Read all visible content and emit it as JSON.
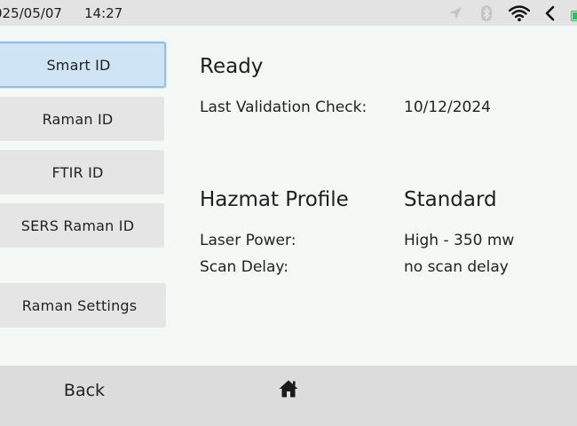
{
  "statusbar": {
    "date": "025/05/07",
    "time": "14:27",
    "icons": [
      "location-icon",
      "bluetooth-icon",
      "wifi-icon",
      "back-chevron-icon",
      "battery-icon"
    ],
    "battery_color": "#22c55e"
  },
  "nav": {
    "items": [
      {
        "label": "Smart ID",
        "selected": true
      },
      {
        "label": "Raman ID",
        "selected": false
      },
      {
        "label": "FTIR ID",
        "selected": false
      },
      {
        "label": "SERS Raman ID",
        "selected": false
      },
      {
        "label": "Raman Settings",
        "selected": false
      }
    ],
    "selected_color": "#cfe4f5",
    "selected_border": "#8ec0e8"
  },
  "main": {
    "status": "Ready",
    "validation": {
      "label": "Last Validation Check:",
      "value": "10/12/2024"
    },
    "profile": {
      "label": "Hazmat Profile",
      "value": "Standard"
    },
    "laser": {
      "label": "Laser Power:",
      "value": "High - 350 mw"
    },
    "scan_delay": {
      "label": "Scan Delay:",
      "value": "no scan delay"
    }
  },
  "bottombar": {
    "back_label": "Back",
    "home_icon": "home-icon"
  }
}
